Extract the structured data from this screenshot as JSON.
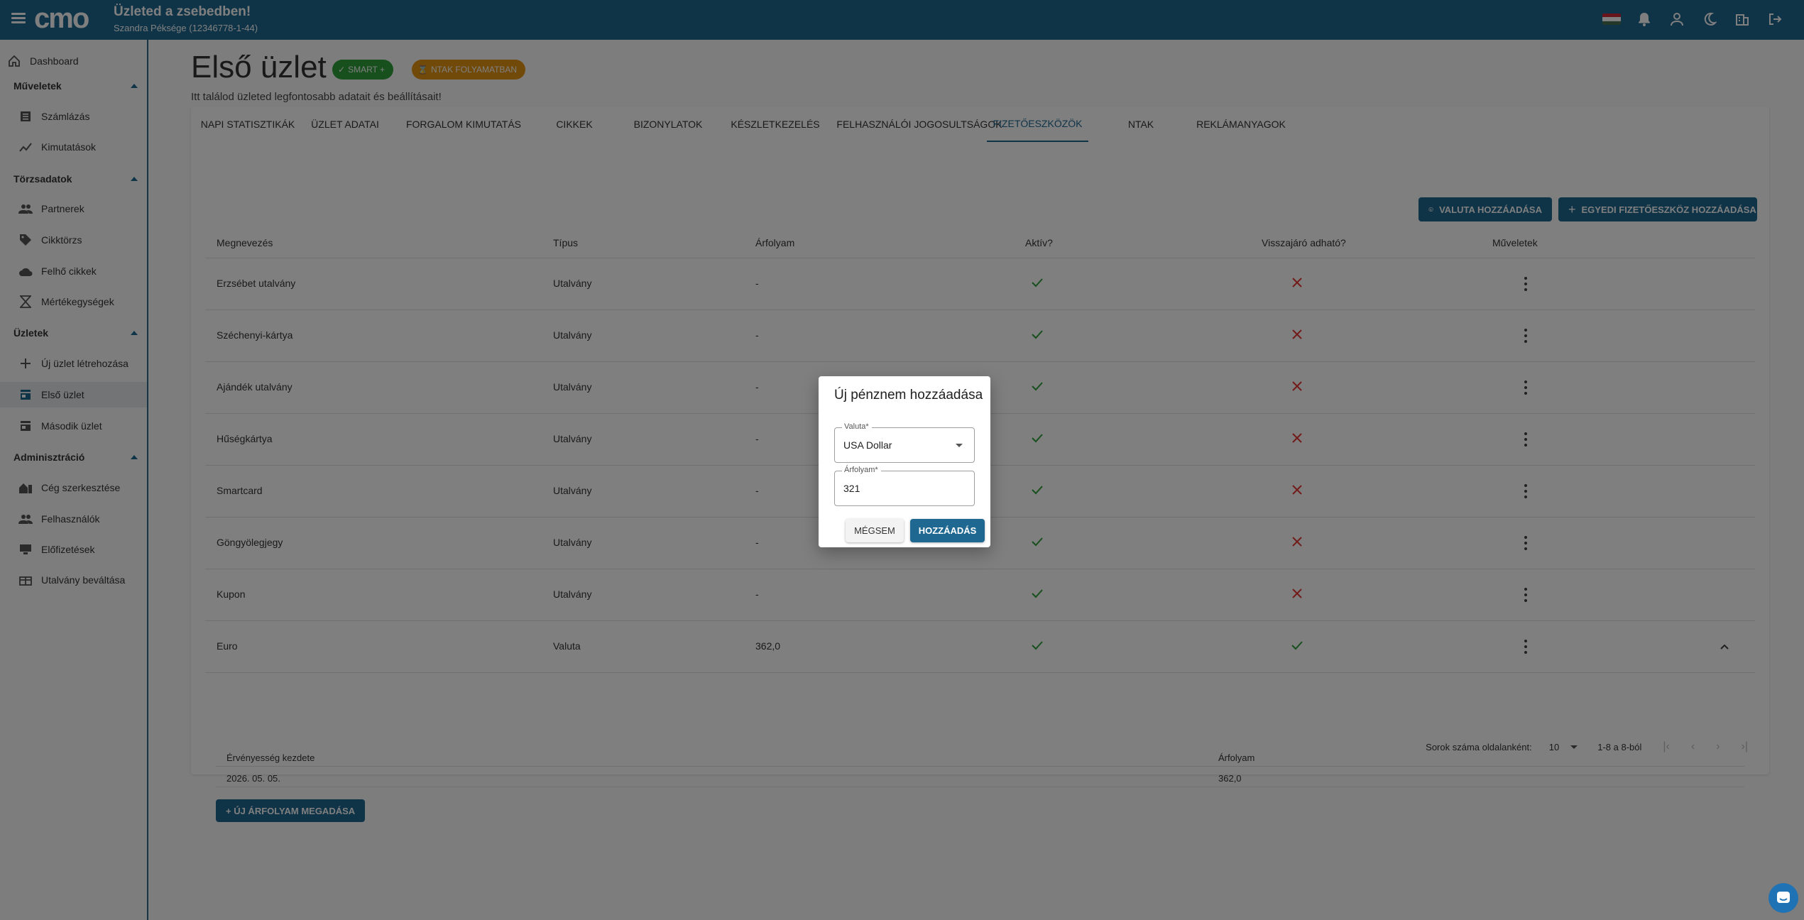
{
  "topbar": {
    "title": "Üzleted a zsebedben!",
    "subtitle": "Szandra Péksége (12346778-1-44)",
    "logo_icon": "cmo-logo",
    "icons": [
      "hungarian-flag-icon",
      "bell-icon",
      "user-icon",
      "moon-icon",
      "building-icon",
      "logout-icon"
    ]
  },
  "sidebar": {
    "dashboard": "Dashboard",
    "sections": {
      "muveletek": "Műveletek",
      "torzsadatok": "Törzsadatok",
      "uzletek": "Üzletek",
      "adminisztracio": "Adminisztráció"
    },
    "items": {
      "szamlazas": "Számlázás",
      "kimutatasok": "Kimutatások",
      "partnerek": "Partnerek",
      "cikktorzs": "Cikktörzs",
      "felho_cikkek": "Felhő cikkek",
      "mertekegysegek": "Mértékegységek",
      "uj_uzlet": "Új üzlet létrehozása",
      "elso_uzlet": "Első üzlet",
      "masodik_uzlet": "Második üzlet",
      "ceg_szerkesztese": "Cég szerkesztése",
      "felhasznalok": "Felhasználók",
      "elofizetesek": "Előfizetések",
      "utalvany_bevaltasa": "Utalvány beváltása"
    }
  },
  "page": {
    "title": "Első üzlet",
    "chip_smart": "SMART +",
    "chip_ntak": "NTAK folyamatban",
    "description": "Itt találod üzleted legfontosabb adatait és beállításait!"
  },
  "tabs": [
    "Napi statisztikák",
    "Üzlet adatai",
    "Forgalom kimutatás",
    "Cikkek",
    "Bizonylatok",
    "Készletkezelés",
    "Felhasználói jogosultságok",
    "Fizetőeszközök",
    "NTAK",
    "Reklámanyagok"
  ],
  "actions": {
    "add_currency": "Valuta hozzáadása",
    "add_custom_payment": "Egyedi fizetőeszköz hozzáadása"
  },
  "table": {
    "headers": {
      "name": "Megnevezés",
      "type": "Típus",
      "rate": "Árfolyam",
      "active": "Aktív?",
      "change": "Visszajáró adható?",
      "ops": "Műveletek"
    },
    "rows": [
      {
        "name": "Erzsébet utalvány",
        "type": "Utalvány",
        "rate": "-",
        "active": true,
        "change": false
      },
      {
        "name": "Széchenyi-kártya",
        "type": "Utalvány",
        "rate": "-",
        "active": true,
        "change": false
      },
      {
        "name": "Ajándék utalvány",
        "type": "Utalvány",
        "rate": "-",
        "active": true,
        "change": false
      },
      {
        "name": "Hűségkártya",
        "type": "Utalvány",
        "rate": "-",
        "active": true,
        "change": false
      },
      {
        "name": "Smartcard",
        "type": "Utalvány",
        "rate": "-",
        "active": true,
        "change": false
      },
      {
        "name": "Göngyölegjegy",
        "type": "Utalvány",
        "rate": "-",
        "active": true,
        "change": false
      },
      {
        "name": "Kupon",
        "type": "Utalvány",
        "rate": "-",
        "active": true,
        "change": false
      },
      {
        "name": "Euro",
        "type": "Valuta",
        "rate": "362,0",
        "active": true,
        "change": true
      }
    ],
    "subtable": {
      "header_validity": "Érvényesség kezdete",
      "header_rate": "Árfolyam",
      "row_date": "2026. 05. 05.",
      "row_rate": "362,0"
    },
    "new_rate_button": "+ Új árfolyam megadása"
  },
  "pagination": {
    "rows_per_page_label": "Sorok száma oldalanként:",
    "rows_per_page": "10",
    "range": "1-8 a 8-ból"
  },
  "dialog": {
    "title": "Új pénznem hozzáadása",
    "currency_label": "Valuta*",
    "currency_value": "USA Dollar",
    "rate_label": "Árfolyam*",
    "rate_value": "321",
    "cancel": "Mégsem",
    "add": "Hozzáadás"
  },
  "colors": {
    "primary": "#1f6891",
    "success": "#2e9e3a",
    "error": "#e53935",
    "warning": "#e29512"
  }
}
